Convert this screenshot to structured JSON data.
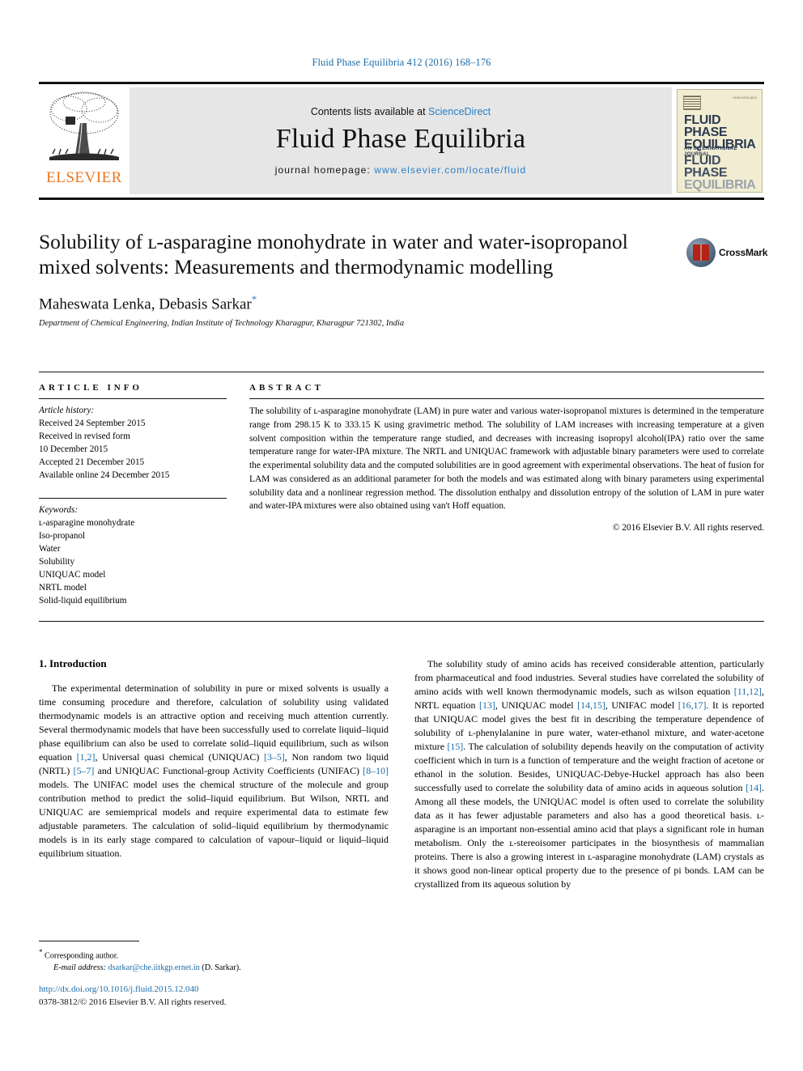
{
  "running_head": "Fluid Phase Equilibria 412 (2016) 168–176",
  "masthead": {
    "publisher_name": "ELSEVIER",
    "publisher_logo_icon": "elsevier-tree-logo",
    "contents_prefix": "Contents lists available at ",
    "contents_link": "ScienceDirect",
    "journal_title": "Fluid Phase Equilibria",
    "homepage_prefix": "journal homepage: ",
    "homepage_url": "www.elsevier.com/locate/fluid",
    "cover": {
      "issn_line": "ISSN 0378-3812",
      "line1": "FLUID PHASE",
      "line2": "EQUILIBRIA",
      "subtitle": "AN INTERNATIONAL JOURNAL",
      "line3": "FLUID PHASE",
      "line4": "EQUILIBRIA"
    }
  },
  "article": {
    "title": "Solubility of ʟ-asparagine monohydrate in water and water-isopropanol mixed solvents: Measurements and thermodynamic modelling",
    "authors": "Maheswata Lenka, Debasis Sarkar",
    "corresponding_mark": "*",
    "affiliation": "Department of Chemical Engineering, Indian Institute of Technology Kharagpur, Kharagpur 721302, India",
    "crossmark_label": "CrossMark",
    "crossmark_icon": "crossmark-badge-icon"
  },
  "article_info": {
    "heading": "ARTICLE INFO",
    "history_label": "Article history:",
    "history": [
      "Received 24 September 2015",
      "Received in revised form",
      "10 December 2015",
      "Accepted 21 December 2015",
      "Available online 24 December 2015"
    ],
    "keywords_label": "Keywords:",
    "keywords": [
      "ʟ-asparagine monohydrate",
      "Iso-propanol",
      "Water",
      "Solubility",
      "UNIQUAC model",
      "NRTL model",
      "Solid-liquid equilibrium"
    ]
  },
  "abstract": {
    "heading": "ABSTRACT",
    "text": "The solubility of ʟ-asparagine monohydrate (LAM) in pure water and various water-isopropanol mixtures is determined in the temperature range from 298.15 K to 333.15 K using gravimetric method. The solubility of LAM increases with increasing temperature at a given solvent composition within the temperature range studied, and decreases with increasing isopropyl alcohol(IPA) ratio over the same temperature range for water-IPA mixture. The NRTL and UNIQUAC framework with adjustable binary parameters were used to correlate the experimental solubility data and the computed solubilities are in good agreement with experimental observations. The heat of fusion for LAM was considered as an additional parameter for both the models and was estimated along with binary parameters using experimental solubility data and a nonlinear regression method. The dissolution enthalpy and dissolution entropy of the solution of LAM in pure water and water-IPA mixtures were also obtained using van't Hoff equation.",
    "copyright": "© 2016 Elsevier B.V. All rights reserved."
  },
  "introduction": {
    "heading": "1. Introduction",
    "left_paragraph_part1": "The experimental determination of solubility in pure or mixed solvents is usually a time consuming procedure and therefore, calculation of solubility using validated thermodynamic models is an attractive option and receiving much attention currently. Several thermodynamic models that have been successfully used to correlate liquid–liquid phase equilibrium can also be used to correlate solid–liquid equilibrium, such as wilson equation ",
    "ref_1_2": "[1,2]",
    "left_paragraph_part2": ", Universal quasi chemical (UNIQUAC) ",
    "ref_3_5": "[3–5]",
    "left_paragraph_part3": ", Non random two liquid (NRTL) ",
    "ref_5_7": "[5–7]",
    "left_paragraph_part4": " and UNIQUAC Functional-group Activity Coefficients (UNIFAC) ",
    "ref_8_10": "[8–10]",
    "left_paragraph_part5": " models. The UNIFAC model uses the chemical structure of the molecule and group contribution method to predict the solid–liquid equilibrium. But Wilson, NRTL and UNIQUAC are semiemprical models and require experimental data to estimate few adjustable parameters. The calculation of solid–liquid equilibrium by thermodynamic models is in its early stage compared to calculation of vapour–liquid or liquid–liquid equilibrium situation.",
    "right_paragraph_part1": "The solubility study of amino acids has received considerable attention, particularly from pharmaceutical and food industries. Several studies have correlated the solubility of amino acids with well known thermodynamic models, such as wilson equation ",
    "ref_11_12": "[11,12]",
    "right_paragraph_part2": ", NRTL equation ",
    "ref_13": "[13]",
    "right_paragraph_part3": ", UNIQUAC model ",
    "ref_14_15": "[14,15]",
    "right_paragraph_part4": ", UNIFAC model ",
    "ref_16_17": "[16,17]",
    "right_paragraph_part5": ". It is reported that UNIQUAC model gives the best fit in describing the temperature dependence of solubility of ʟ-phenylalanine in pure water, water-ethanol mixture, and water-acetone mixture ",
    "ref_15": "[15]",
    "right_paragraph_part6": ". The calculation of solubility depends heavily on the computation of activity coefficient which in turn is a function of temperature and the weight fraction of acetone or ethanol in the solution. Besides, UNIQUAC-Debye-Huckel approach has also been successfully used to correlate the solubility data of amino acids in aqueous solution ",
    "ref_14": "[14]",
    "right_paragraph_part7": ". Among all these models, the UNIQUAC model is often used to correlate the solubility data as it has fewer adjustable parameters and also has a good theoretical basis. ʟ-asparagine is an important non-essential amino acid that plays a significant role in human metabolism. Only the ʟ-stereoisomer participates in the biosynthesis of mammalian proteins. There is also a growing interest in ʟ-asparagine monohydrate (LAM) crystals as it shows good non-linear optical property due to the presence of pi bonds. LAM can be crystallized from its aqueous solution by"
  },
  "footnote": {
    "corresponding_mark": "*",
    "corresponding_text": "Corresponding author.",
    "email_label": "E-mail address:",
    "email": "dsarkar@che.iitkgp.ernet.in",
    "email_owner": "(D. Sarkar)."
  },
  "footer": {
    "doi": "http://dx.doi.org/10.1016/j.fluid.2015.12.040",
    "issn_line": "0378-3812/© 2016 Elsevier B.V. All rights reserved."
  },
  "colors": {
    "link": "#1b6ca8",
    "accent_orange": "#e87722",
    "band_gray": "#e6e6e6"
  }
}
